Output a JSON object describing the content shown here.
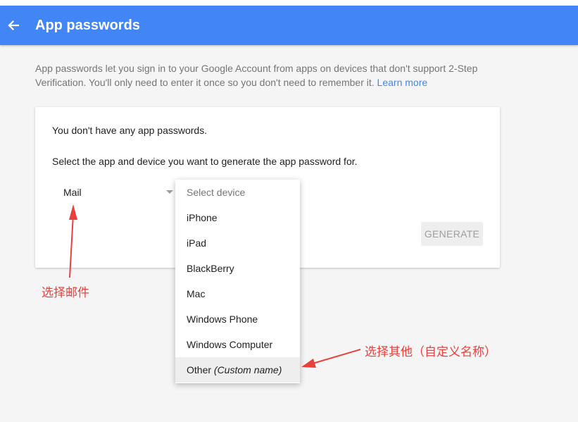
{
  "header": {
    "title": "App passwords",
    "back_icon": "arrow-left-icon",
    "color": "#4285f4"
  },
  "description": {
    "text": "App passwords let you sign in to your Google Account from apps on devices that don't support 2-Step Verification. You'll only need to enter it once so you don't need to remember it.",
    "learn_more": "Learn more"
  },
  "card": {
    "empty_message": "You don't have any app passwords.",
    "instruction": "Select the app and device you want to generate the app password for.",
    "app_select_value": "Mail",
    "generate_label": "GENERATE"
  },
  "device_menu": {
    "header": "Select device",
    "items": [
      {
        "label": "iPhone"
      },
      {
        "label": "iPad"
      },
      {
        "label": "BlackBerry"
      },
      {
        "label": "Mac"
      },
      {
        "label": "Windows Phone"
      },
      {
        "label": "Windows Computer"
      }
    ],
    "other_label": "Other",
    "other_hint": "(Custom name)"
  },
  "annotations": {
    "mail": "选择邮件",
    "other": "选择其他（自定义名称）",
    "color": "#e8403a"
  }
}
